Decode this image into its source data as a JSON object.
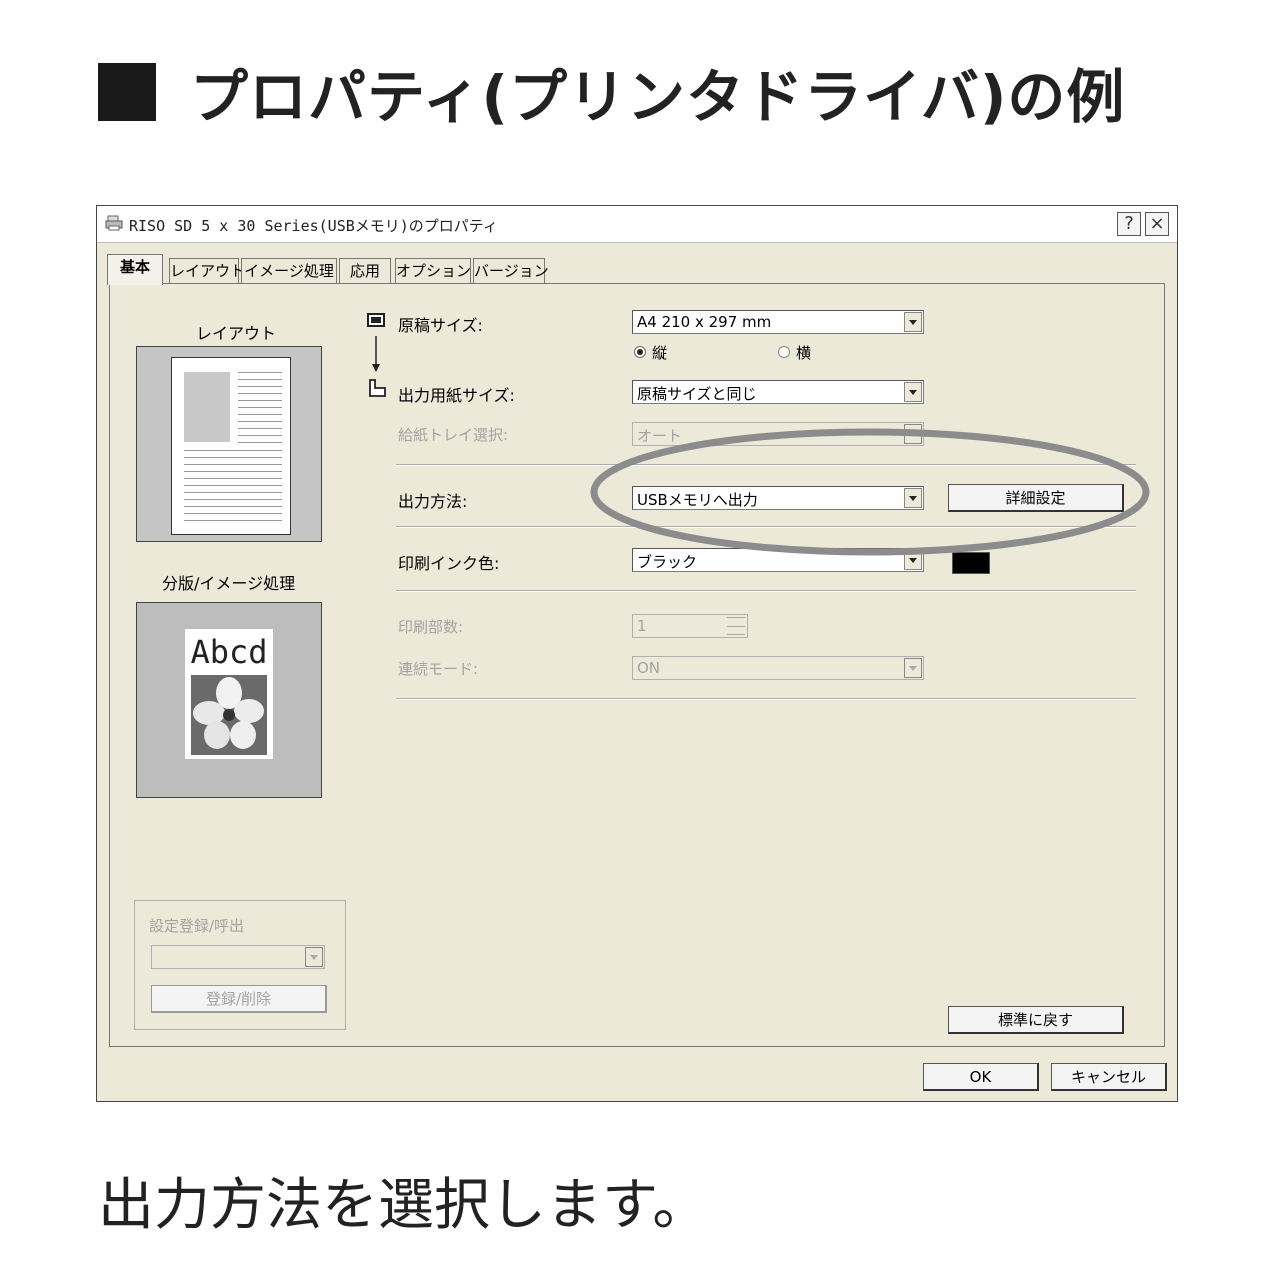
{
  "heading": {
    "text": "プロパティ(プリンタドライバ)の例"
  },
  "caption": {
    "text": "出力方法を選択します。"
  },
  "window": {
    "title": "RISO SD 5 x 30 Series(USBメモリ)のプロパティ",
    "help_label": "?",
    "close_label": "×"
  },
  "tabs": [
    {
      "label": "基本"
    },
    {
      "label": "レイアウト"
    },
    {
      "label": "イメージ処理"
    },
    {
      "label": "応用"
    },
    {
      "label": "オプション"
    },
    {
      "label": "バージョン"
    }
  ],
  "left": {
    "layout_label": "レイアウト",
    "separation_label": "分版/イメージ処理",
    "sample_text": "Abcd",
    "preset_group_label": "設定登録/呼出",
    "preset_value": "",
    "register_delete_label": "登録/削除"
  },
  "form": {
    "original_size": {
      "label": "原稿サイズ:",
      "value": "A4 210 x 297 mm"
    },
    "orientation": {
      "portrait_label": "縦",
      "landscape_label": "横",
      "selected": "縦"
    },
    "output_paper_size": {
      "label": "出力用紙サイズ:",
      "value": "原稿サイズと同じ"
    },
    "paper_tray": {
      "label": "給紙トレイ選択:",
      "value": "オート"
    },
    "output_method": {
      "label": "出力方法:",
      "value": "USBメモリへ出力",
      "detail_button": "詳細設定"
    },
    "ink_color": {
      "label": "印刷インク色:",
      "value": "ブラック",
      "swatch_color": "#000000"
    },
    "copies": {
      "label": "印刷部数:",
      "value": "1"
    },
    "continuous_mode": {
      "label": "連続モード:",
      "value": "ON"
    }
  },
  "buttons": {
    "reset": "標準に戻す",
    "ok": "OK",
    "cancel": "キャンセル"
  },
  "colors": {
    "dialog_bg": "#ece9d8",
    "highlight_ellipse": "#8c8c8c"
  }
}
